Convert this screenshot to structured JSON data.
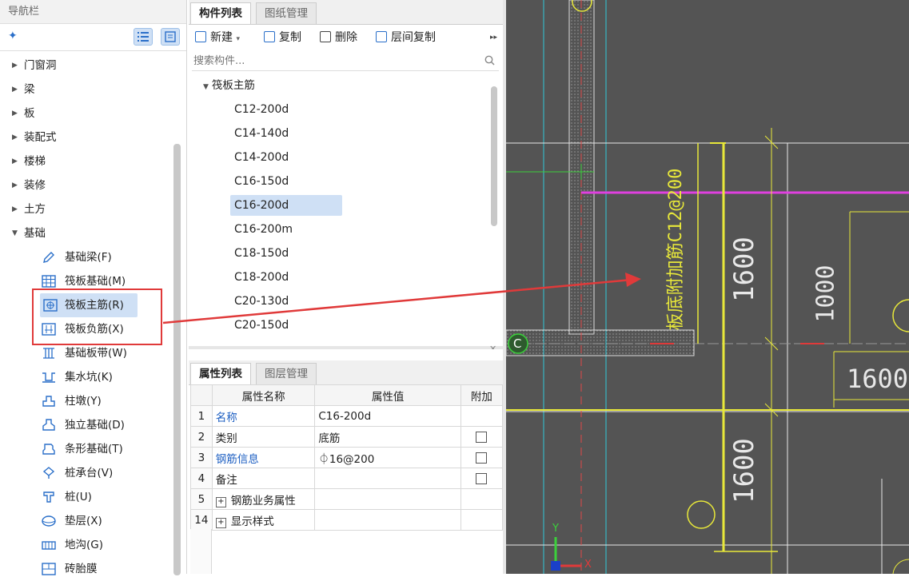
{
  "nav": {
    "title": "导航栏",
    "categories": [
      "门窗洞",
      "梁",
      "板",
      "装配式",
      "楼梯",
      "装修",
      "土方",
      "基础"
    ],
    "sub_items": [
      "基础梁(F)",
      "筏板基础(M)",
      "筏板主筋(R)",
      "筏板负筋(X)",
      "基础板带(W)",
      "集水坑(K)",
      "柱墩(Y)",
      "独立基础(D)",
      "条形基础(T)",
      "桩承台(V)",
      "桩(U)",
      "垫层(X)",
      "地沟(G)",
      "砖胎膜"
    ]
  },
  "component_panel": {
    "tabs": [
      "构件列表",
      "图纸管理"
    ],
    "toolbar": {
      "new": "新建",
      "copy": "复制",
      "delete": "删除",
      "floor_copy": "层间复制"
    },
    "search_placeholder": "搜索构件...",
    "tree_root": "筏板主筋",
    "items": [
      "C12-200d",
      "C14-140d",
      "C14-200d",
      "C16-150d",
      "C16-200d",
      "C16-200m",
      "C18-150d",
      "C18-200d",
      "C20-130d",
      "C20-150d"
    ],
    "selected": "C16-200d"
  },
  "property_panel": {
    "tabs": [
      "属性列表",
      "图层管理"
    ],
    "headers": {
      "name": "属性名称",
      "value": "属性值",
      "extra": "附加"
    },
    "rows": [
      {
        "num": "1",
        "name": "名称",
        "value": "C16-200d"
      },
      {
        "num": "2",
        "name": "类别",
        "value": "底筋"
      },
      {
        "num": "3",
        "name": "钢筋信息",
        "value": "⏀16@200"
      },
      {
        "num": "4",
        "name": "备注",
        "value": ""
      },
      {
        "num": "5",
        "name": "钢筋业务属性",
        "value": ""
      },
      {
        "num": "14",
        "name": "显示样式",
        "value": ""
      }
    ]
  },
  "cad": {
    "dim_1600_a": "1600",
    "dim_1000": "1000",
    "dim_1600_b": "1600",
    "dim_1600_c": "1600",
    "rebar_text": "板底附加筋C12@200",
    "axis_label": "C",
    "axis_y": "Y",
    "axis_x": "X"
  },
  "colors": {
    "selection": "#cfe0f5",
    "cad_bg": "#545454",
    "annotation": "#e03a3a"
  }
}
